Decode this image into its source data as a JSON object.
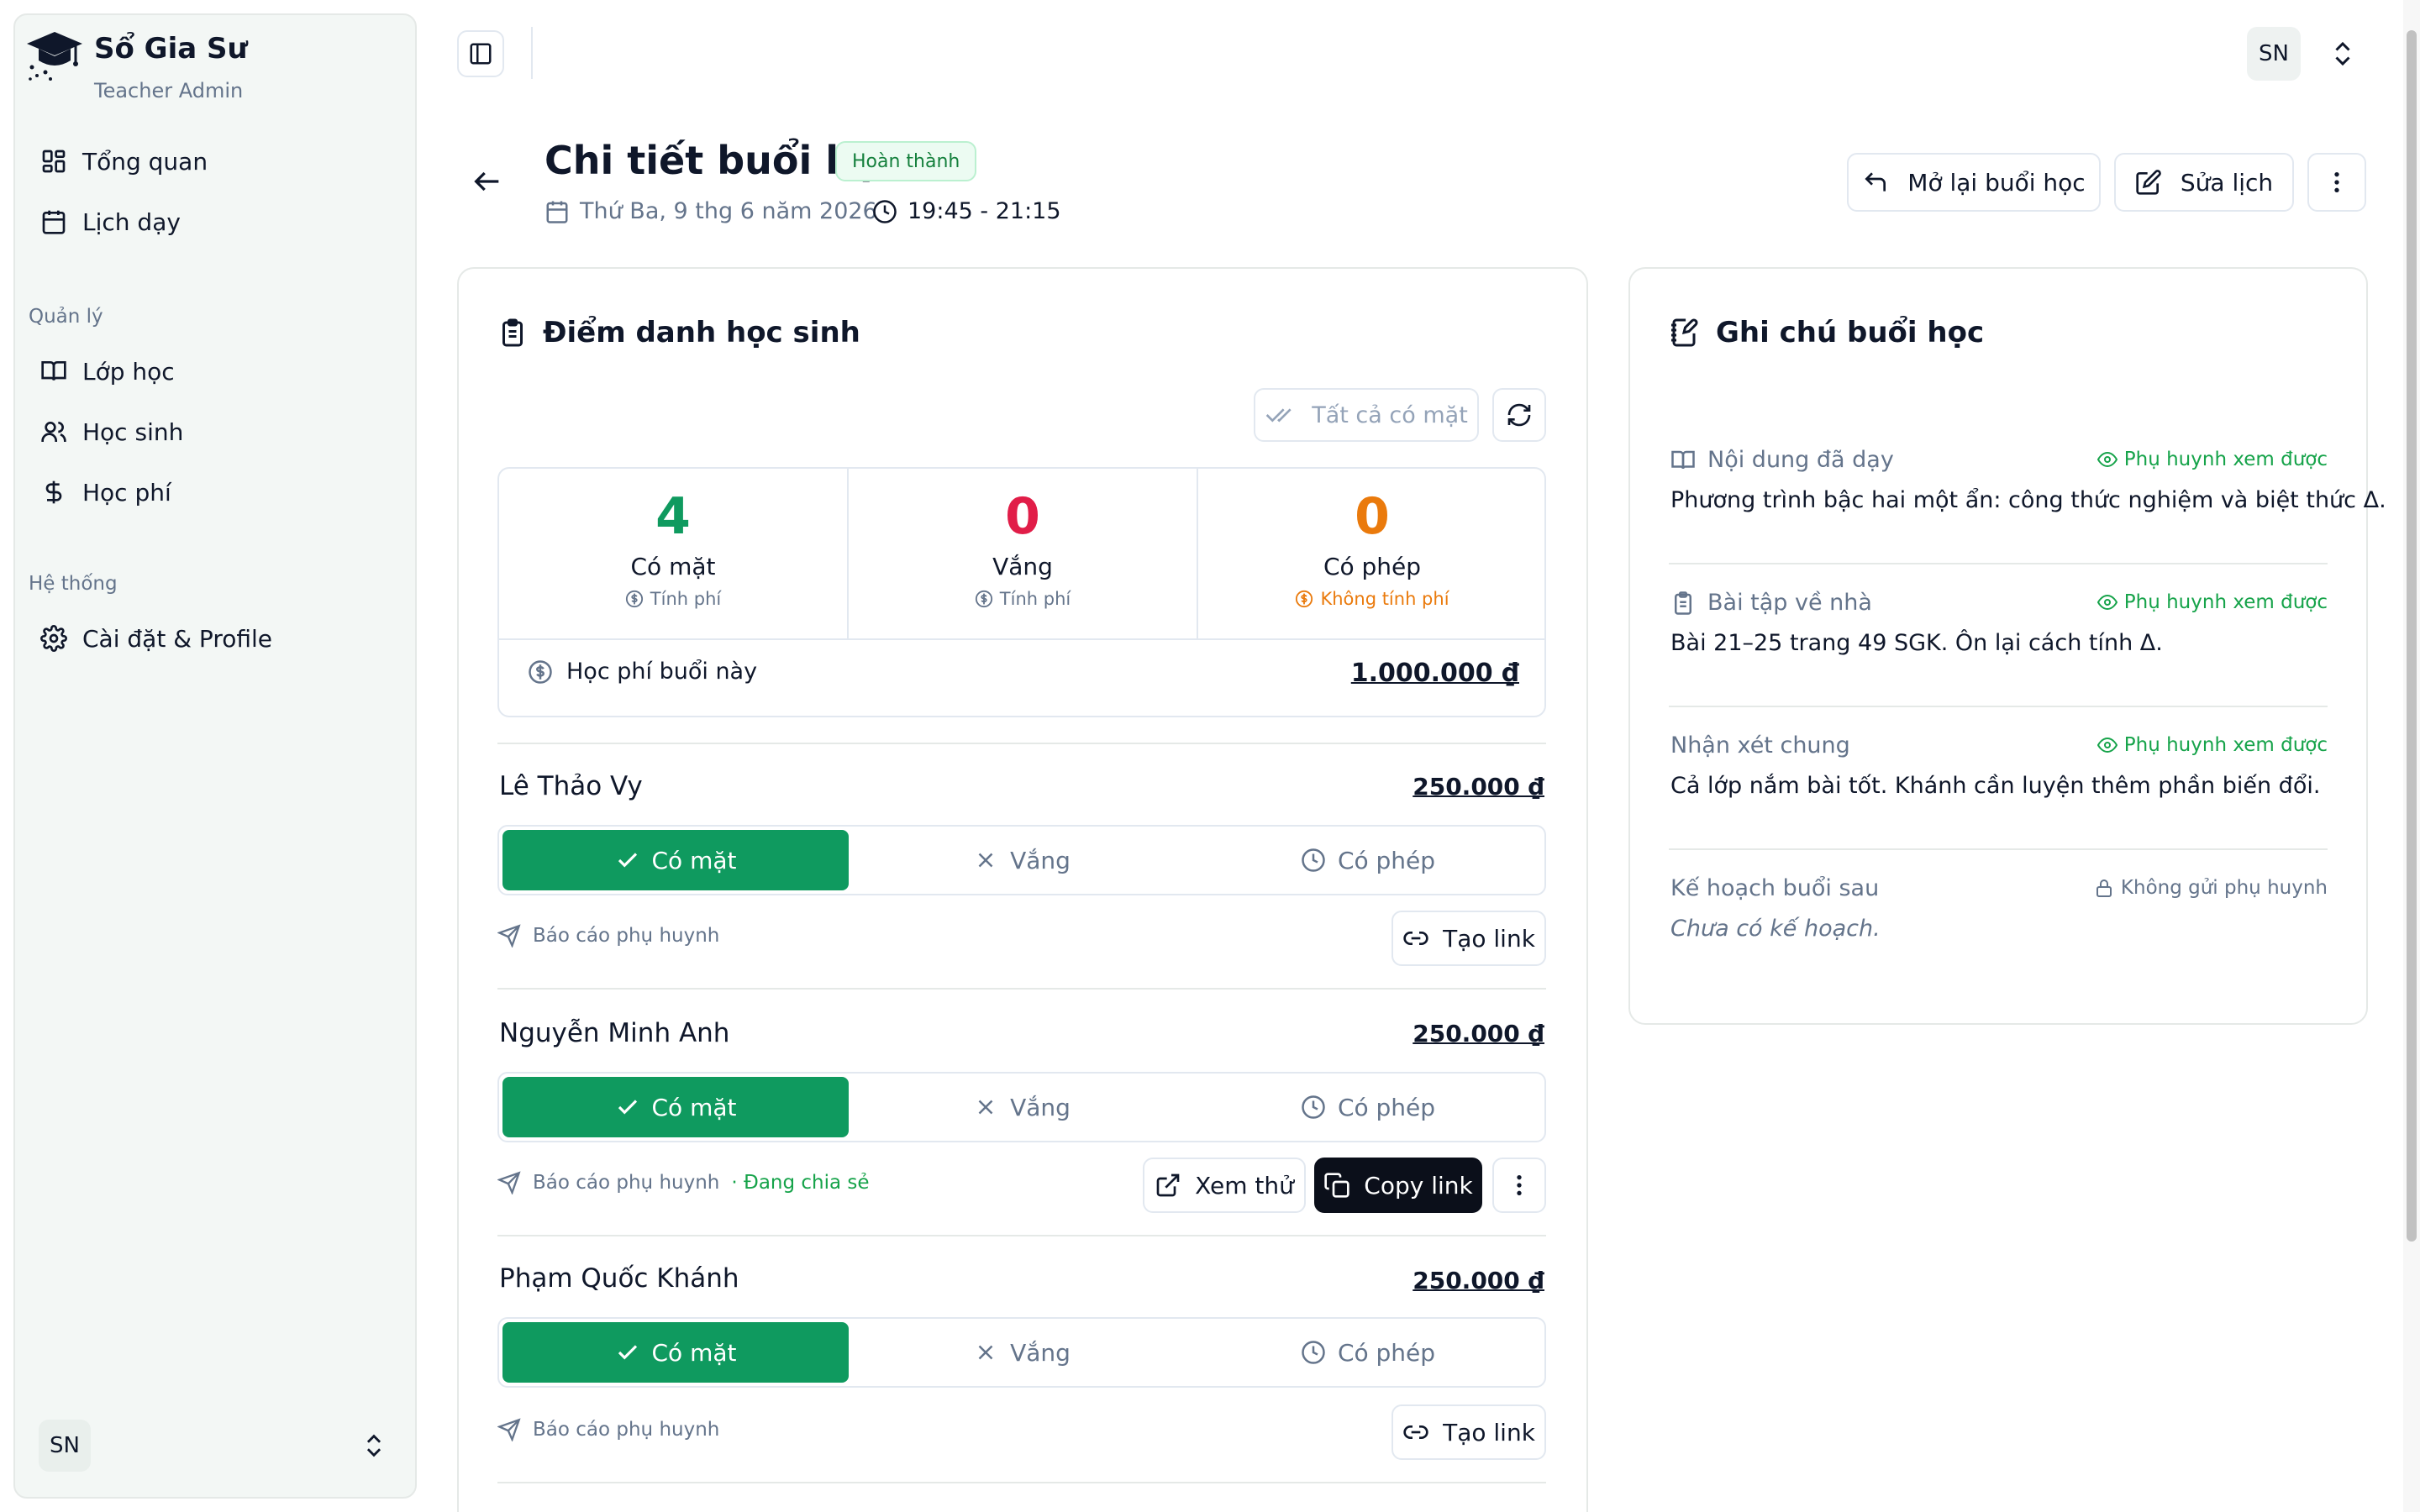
{
  "app": {
    "title": "Sổ Gia Sư",
    "subtitle": "Teacher Admin"
  },
  "sidebar": {
    "main_items": [
      {
        "label": "Tổng quan",
        "icon": "dashboard-icon"
      },
      {
        "label": "Lịch dạy",
        "icon": "calendar-icon"
      }
    ],
    "sections": [
      {
        "label": "Quản lý",
        "items": [
          {
            "label": "Lớp học",
            "icon": "book-icon"
          },
          {
            "label": "Học sinh",
            "icon": "users-icon"
          },
          {
            "label": "Học phí",
            "icon": "dollar-icon"
          }
        ]
      },
      {
        "label": "Hệ thống",
        "items": [
          {
            "label": "Cài đặt & Profile",
            "icon": "gear-icon"
          }
        ]
      }
    ],
    "user_initials": "SN"
  },
  "topbar": {
    "user_initials": "SN"
  },
  "header": {
    "title": "Chi tiết buổi học",
    "status": "Hoàn thành",
    "date": "Thứ Ba, 9 thg 6 năm 2026",
    "time": "19:45 - 21:15",
    "reopen_label": "Mở lại buổi học",
    "edit_label": "Sửa lịch"
  },
  "attendance": {
    "title": "Điểm danh học sinh",
    "all_present_label": "Tất cả có mặt",
    "stats": [
      {
        "value": "4",
        "label": "Có mặt",
        "note": "Tính phí",
        "color": "#0f9a5f"
      },
      {
        "value": "0",
        "label": "Vắng",
        "note": "Tính phí",
        "color": "#e11d48"
      },
      {
        "value": "0",
        "label": "Có phép",
        "note": "Không tính phí",
        "color": "#ea7a0c"
      }
    ],
    "fee_label": "Học phí buổi này",
    "fee_total": "1.000.000 ₫",
    "options": {
      "present": "Có mặt",
      "absent": "Vắng",
      "excused": "Có phép"
    },
    "report_label": "Báo cáo phụ huynh",
    "shared_label": "· Đang chia sẻ",
    "create_link_label": "Tạo link",
    "preview_label": "Xem thử",
    "copy_link_label": "Copy link",
    "students": [
      {
        "name": "Lê Thảo Vy",
        "fee": "250.000 ₫",
        "status": "present"
      },
      {
        "name": "Nguyễn Minh Anh",
        "fee": "250.000 ₫",
        "status": "present"
      },
      {
        "name": "Phạm Quốc Khánh",
        "fee": "250.000 ₫",
        "status": "present"
      }
    ]
  },
  "notes": {
    "title": "Ghi chú buổi học",
    "visible_label": "Phụ huynh xem được",
    "private_label": "Không gửi phụ huynh",
    "items": [
      {
        "title": "Nội dung đã dạy",
        "content": "Phương trình bậc hai một ẩn: công thức nghiệm và biệt thức Δ."
      },
      {
        "title": "Bài tập về nhà",
        "content": "Bài 21–25 trang 49 SGK. Ôn lại cách tính Δ."
      },
      {
        "title": "Nhận xét chung",
        "content": "Cả lớp nắm bài tốt. Khánh cần luyện thêm phần biến đổi."
      },
      {
        "title": "Kế hoạch buổi sau",
        "content": "Chưa có kế hoạch."
      }
    ]
  }
}
